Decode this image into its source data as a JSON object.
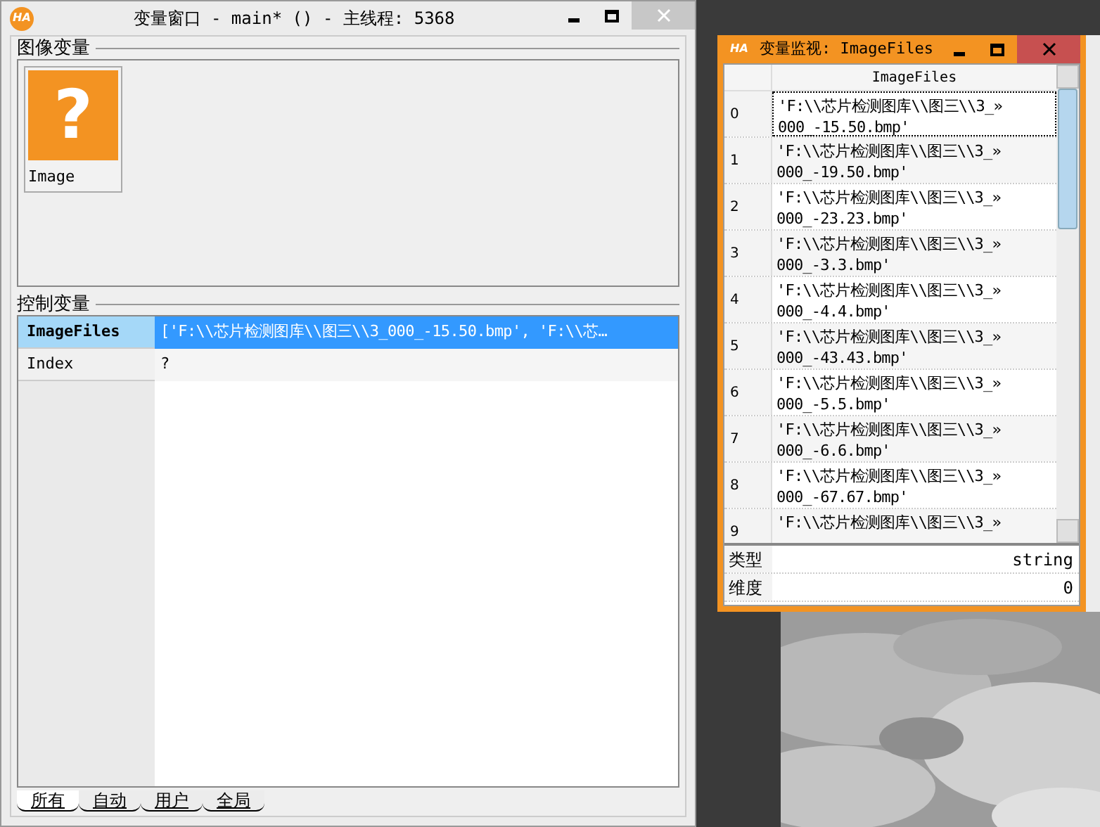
{
  "main_window": {
    "title": "变量窗口 - main* () - 主线程: 5368",
    "logo": "HA",
    "image_section": {
      "title": "图像变量",
      "items": [
        {
          "label": "Image",
          "glyph": "?"
        }
      ]
    },
    "control_section": {
      "title": "控制变量",
      "rows": [
        {
          "name": "ImageFiles",
          "value": "['F:\\\\芯片检测图库\\\\图三\\\\3_000_-15.50.bmp', 'F:\\\\芯…",
          "selected": true
        },
        {
          "name": "Index",
          "value": "?",
          "selected": false
        }
      ]
    },
    "tabs": [
      {
        "label": "所有",
        "selected": true
      },
      {
        "label": "自动",
        "selected": false
      },
      {
        "label": "用户",
        "selected": false
      },
      {
        "label": "全局",
        "selected": false
      }
    ]
  },
  "monitor_window": {
    "title": "变量监视: ImageFiles",
    "logo": "HA",
    "column": "ImageFiles",
    "rows": [
      {
        "index": "0",
        "line1": "'F:\\\\芯片检测图库\\\\图三\\\\3_»",
        "line2": "000_-15.50.bmp'",
        "selected": true
      },
      {
        "index": "1",
        "line1": "'F:\\\\芯片检测图库\\\\图三\\\\3_»",
        "line2": "000_-19.50.bmp'",
        "selected": false
      },
      {
        "index": "2",
        "line1": "'F:\\\\芯片检测图库\\\\图三\\\\3_»",
        "line2": "000_-23.23.bmp'",
        "selected": false
      },
      {
        "index": "3",
        "line1": "'F:\\\\芯片检测图库\\\\图三\\\\3_»",
        "line2": "000_-3.3.bmp'",
        "selected": false
      },
      {
        "index": "4",
        "line1": "'F:\\\\芯片检测图库\\\\图三\\\\3_»",
        "line2": "000_-4.4.bmp'",
        "selected": false
      },
      {
        "index": "5",
        "line1": "'F:\\\\芯片检测图库\\\\图三\\\\3_»",
        "line2": "000_-43.43.bmp'",
        "selected": false
      },
      {
        "index": "6",
        "line1": "'F:\\\\芯片检测图库\\\\图三\\\\3_»",
        "line2": "000_-5.5.bmp'",
        "selected": false
      },
      {
        "index": "7",
        "line1": "'F:\\\\芯片检测图库\\\\图三\\\\3_»",
        "line2": "000_-6.6.bmp'",
        "selected": false
      },
      {
        "index": "8",
        "line1": "'F:\\\\芯片检测图库\\\\图三\\\\3_»",
        "line2": "000_-67.67.bmp'",
        "selected": false
      },
      {
        "index": "9",
        "line1": "'F:\\\\芯片检测图库\\\\图三\\\\3_»",
        "selected": false
      }
    ],
    "properties": [
      {
        "label": "类型",
        "value": "string"
      },
      {
        "label": "维度",
        "value": "0"
      }
    ]
  }
}
